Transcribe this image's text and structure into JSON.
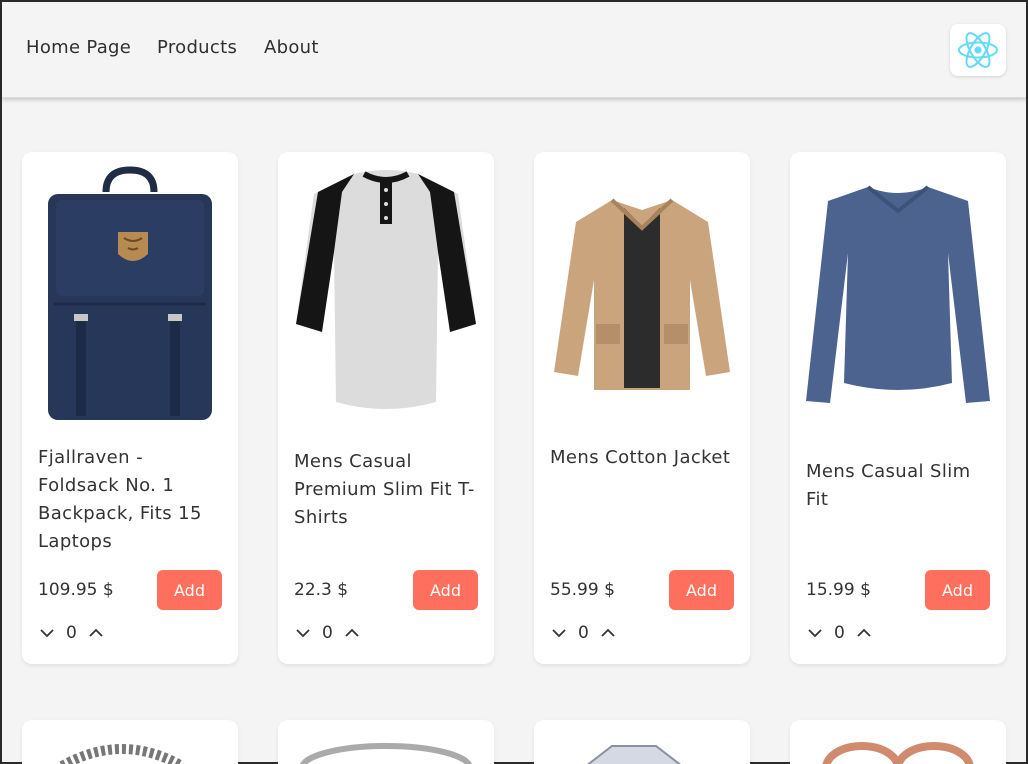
{
  "nav": {
    "links": [
      "Home Page",
      "Products",
      "About"
    ],
    "logo_icon": "react-logo-icon",
    "logo_color": "#61dafb"
  },
  "products": [
    {
      "title": "Fjallraven - Foldsack No. 1 Backpack, Fits 15 Laptops",
      "price": "109.95 $",
      "add_label": "Add",
      "qty": "0",
      "image": "backpack-image"
    },
    {
      "title": "Mens Casual Premium Slim Fit T-Shirts",
      "price": "22.3 $",
      "add_label": "Add",
      "qty": "0",
      "image": "raglan-shirt-image"
    },
    {
      "title": "Mens Cotton Jacket",
      "price": "55.99 $",
      "add_label": "Add",
      "qty": "0",
      "image": "cotton-jacket-image"
    },
    {
      "title": "Mens Casual Slim Fit",
      "price": "15.99 $",
      "add_label": "Add",
      "qty": "0",
      "image": "slim-fit-shirt-image"
    }
  ],
  "colors": {
    "accent": "#ff6f5e",
    "background": "#f4f4f4",
    "card": "#ffffff"
  }
}
